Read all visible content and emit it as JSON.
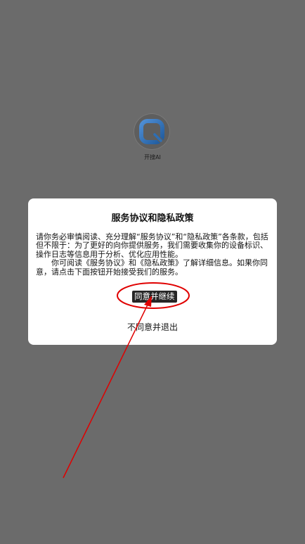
{
  "app": {
    "name": "开搜AI"
  },
  "dialog": {
    "title": "服务协议和隐私政策",
    "paragraph1": "请你务必审慎阅读、充分理解“服务协议”和“隐私政策”各条款，包括但不限于：为了更好的向你提供服务，我们需要收集你的设备标识、操作日志等信息用于分析、优化应用性能。",
    "paragraph2": "你可阅读《服务协议》和《隐私政策》了解详细信息。如果你同意，请点击下面按钮开始接受我们的服务。",
    "agree_label": "同意并继续",
    "disagree_label": "不同意并退出"
  },
  "colors": {
    "background": "#6b6b6b",
    "logo_blue": "#2d6fb5",
    "annotation_red": "#e00000"
  },
  "icons": {
    "logo": "kaisou-logo-icon"
  }
}
